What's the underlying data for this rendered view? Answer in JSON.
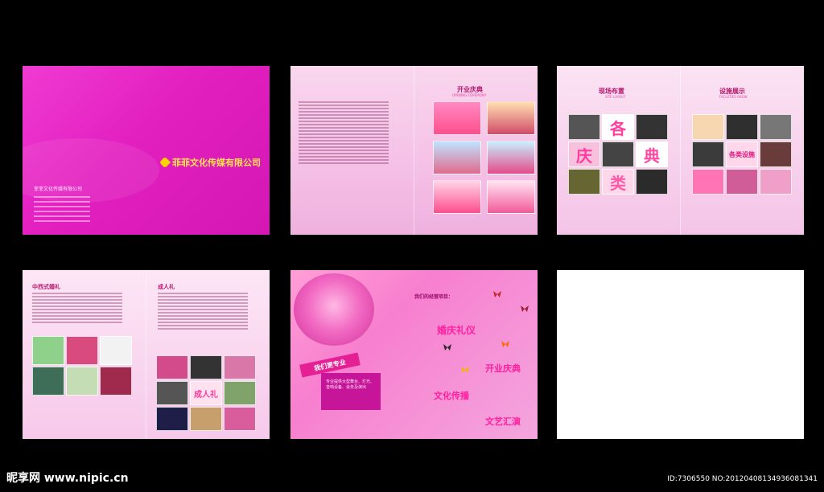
{
  "panel1": {
    "logo_text": "菲菲文化传媒有限公司",
    "small_title": "菲菲文化传媒有限公司"
  },
  "panel2": {
    "header": "开业庆典",
    "subheader": "OPENING CEREMONY"
  },
  "panel3": {
    "left_title": "现场布置",
    "left_sub": "SITE LAYOUT",
    "right_title": "设施展示",
    "right_sub": "FACILITIES SHOW",
    "big_chars": [
      "各",
      "庆",
      "典",
      "类"
    ],
    "right_label": "各类设施"
  },
  "panel4": {
    "left_title": "中西式婚礼",
    "right_title": "成人礼",
    "thumb_label": "成人礼"
  },
  "panel5": {
    "tag": "我们更专业",
    "box_text": "专业提供大型舞台、灯光、音响设备、会务及演出",
    "headline": "我们的经营项目：",
    "services": [
      "婚庆礼仪",
      "开业庆典",
      "文化传播",
      "文艺汇演"
    ]
  },
  "watermark": {
    "site": "昵享网 www.nipic.cn",
    "id": "ID:7306550 NO:20120408134936081341"
  }
}
